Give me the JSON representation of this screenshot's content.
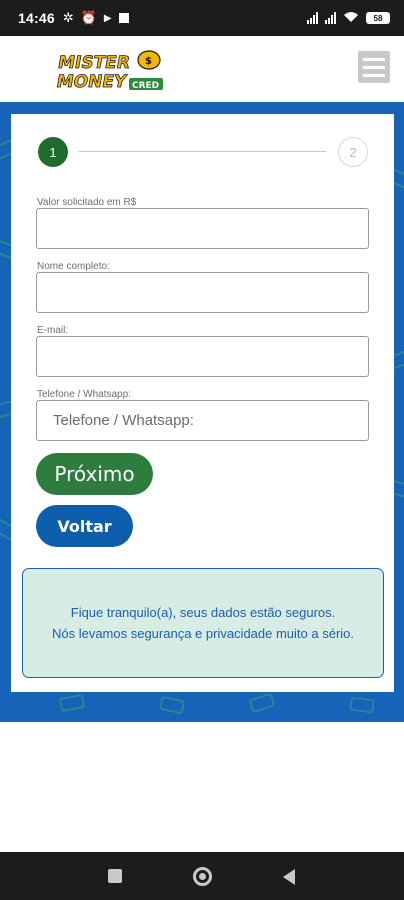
{
  "status_bar": {
    "time": "14:46",
    "battery": "58",
    "icons": [
      "fan-icon",
      "alarm-icon",
      "play-icon",
      "notification-square-icon",
      "signal-icon",
      "wifi-icon",
      "battery-icon"
    ]
  },
  "header": {
    "logo_text": "MISTER MONEY CRED",
    "menu_icon": "hamburger-menu-icon"
  },
  "stepper": {
    "steps": [
      {
        "label": "1",
        "state": "active"
      },
      {
        "label": "2",
        "state": "inactive"
      }
    ]
  },
  "form": {
    "fields": [
      {
        "label": "Valor solicitado em R$",
        "value": "",
        "placeholder": ""
      },
      {
        "label": "Nome completo:",
        "value": "",
        "placeholder": ""
      },
      {
        "label": "E-mail:",
        "value": "",
        "placeholder": ""
      },
      {
        "label": "Telefone / Whatsapp:",
        "value": "",
        "placeholder": "Telefone / Whatsapp:"
      }
    ],
    "next_label": "Próximo",
    "back_label": "Voltar"
  },
  "notice": {
    "line1": "Fique tranquilo(a), seus dados estão seguros.",
    "line2": "Nós levamos segurança e privacidade muito a sério."
  },
  "colors": {
    "brand_blue": "#1763b7",
    "button_green": "#2e7d3e",
    "step_green": "#1e6b2d",
    "button_blue": "#0e5eae",
    "notice_bg": "#d7ece3",
    "logo_yellow": "#f5b800"
  }
}
